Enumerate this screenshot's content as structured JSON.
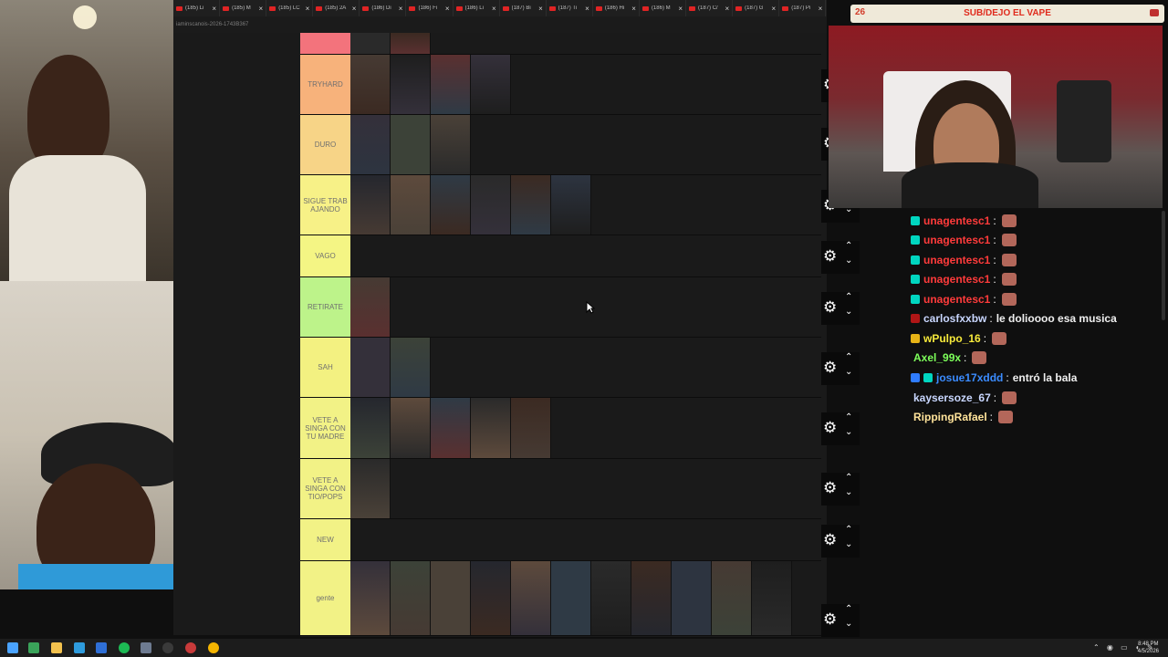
{
  "browser": {
    "tabs": [
      {
        "title": "(185) Li"
      },
      {
        "title": "(185) M"
      },
      {
        "title": "(185) LC"
      },
      {
        "title": "(185) 2A"
      },
      {
        "title": "(186) Di"
      },
      {
        "title": "(186) Fi"
      },
      {
        "title": "(186) Li"
      },
      {
        "title": "(187) Bi"
      },
      {
        "title": "(187) Ti"
      },
      {
        "title": "(186) Hi"
      },
      {
        "title": "(186) M"
      },
      {
        "title": "(187) C/"
      },
      {
        "title": "(187) G"
      },
      {
        "title": "(187) Pi"
      }
    ],
    "close_glyph": "×",
    "url": "iaminscanois-2026-1743B367"
  },
  "tiers": [
    {
      "label": "",
      "color": "#f3737c",
      "thumbs": 2
    },
    {
      "label": "TRYHARD",
      "color": "#f7b27b",
      "thumbs": 4
    },
    {
      "label": "DURO",
      "color": "#f7d487",
      "thumbs": 3
    },
    {
      "label": "SIGUE TRAB AJANDO",
      "color": "#f7f187",
      "thumbs": 6
    },
    {
      "label": "VAGO",
      "color": "#f4f584",
      "thumbs": 0
    },
    {
      "label": "RETIRATE",
      "color": "#bdf38a",
      "thumbs": 1
    },
    {
      "label": "SAH",
      "color": "#f3f181",
      "thumbs": 2
    },
    {
      "label": "VETE A SINGA CON TU MADRE",
      "color": "#f2f286",
      "thumbs": 5
    },
    {
      "label": "VETE A SINGA CON TIO/POPS",
      "color": "#f2f286",
      "thumbs": 1
    },
    {
      "label": "NEW",
      "color": "#f2f286",
      "thumbs": 0
    },
    {
      "label": "gente",
      "color": "#f2f286",
      "thumbs": 11
    }
  ],
  "controls": {
    "gear_glyph": "⚙",
    "up_glyph": "⌃",
    "down_glyph": "⌄"
  },
  "overlay": {
    "count": "26",
    "banner_text": "SUB/DEJO EL VAPE"
  },
  "chat": {
    "messages": [
      {
        "user": "unagentesc1",
        "color": "#ff3b3b",
        "text": "",
        "emote": true,
        "badge": "#00d6c0",
        "badge2": ""
      },
      {
        "user": "unagentesc1",
        "color": "#ff3b3b",
        "text": "",
        "emote": true,
        "badge": "#00d6c0",
        "badge2": ""
      },
      {
        "user": "unagentesc1",
        "color": "#ff3b3b",
        "text": "",
        "emote": true,
        "badge": "#00d6c0",
        "badge2": ""
      },
      {
        "user": "unagentesc1",
        "color": "#ff3b3b",
        "text": "",
        "emote": true,
        "badge": "#00d6c0",
        "badge2": ""
      },
      {
        "user": "unagentesc1",
        "color": "#ff3b3b",
        "text": "",
        "emote": true,
        "badge": "#00d6c0",
        "badge2": ""
      },
      {
        "user": "carlosfxxbw",
        "color": "#c9d7ff",
        "text": "le dolioooo esa musica",
        "emote": false,
        "badge": "#b11616",
        "badge2": ""
      },
      {
        "user": "wPulpo_16",
        "color": "#f7ea3b",
        "text": "",
        "emote": true,
        "badge": "#e8b416",
        "badge2": ""
      },
      {
        "user": "Axel_99x",
        "color": "#7dff5a",
        "text": "",
        "emote": true,
        "badge": "",
        "badge2": ""
      },
      {
        "user": "josue17xddd",
        "color": "#3b8cff",
        "text": "entró la bala",
        "emote": false,
        "badge": "#2f7cff",
        "badge2": "#00d6c0"
      },
      {
        "user": "kaysersoze_67",
        "color": "#c9d7ff",
        "text": "",
        "emote": true,
        "badge": "",
        "badge2": ""
      },
      {
        "user": "RippingRafael",
        "color": "#ffe39a",
        "text": "",
        "emote": true,
        "badge": "",
        "badge2": ""
      }
    ]
  },
  "taskbar": {
    "icons": [
      {
        "name": "windows-start-icon",
        "color": "#4aa3ff"
      },
      {
        "name": "terminal-icon",
        "color": "#3aa35a"
      },
      {
        "name": "file-explorer-icon",
        "color": "#f2c14e"
      },
      {
        "name": "browser-icon",
        "color": "#2e9bdd"
      },
      {
        "name": "app-icon",
        "color": "#2f6fd6"
      },
      {
        "name": "spotify-icon",
        "color": "#1db954"
      },
      {
        "name": "app-grid-icon",
        "color": "#6e7b91"
      },
      {
        "name": "obs-icon",
        "color": "#3a3a3a"
      },
      {
        "name": "recorder-icon",
        "color": "#c83a3a"
      },
      {
        "name": "chrome-icon",
        "color": "#f4b400"
      }
    ],
    "time": "8:48 PM",
    "date": "4/5/2026"
  }
}
